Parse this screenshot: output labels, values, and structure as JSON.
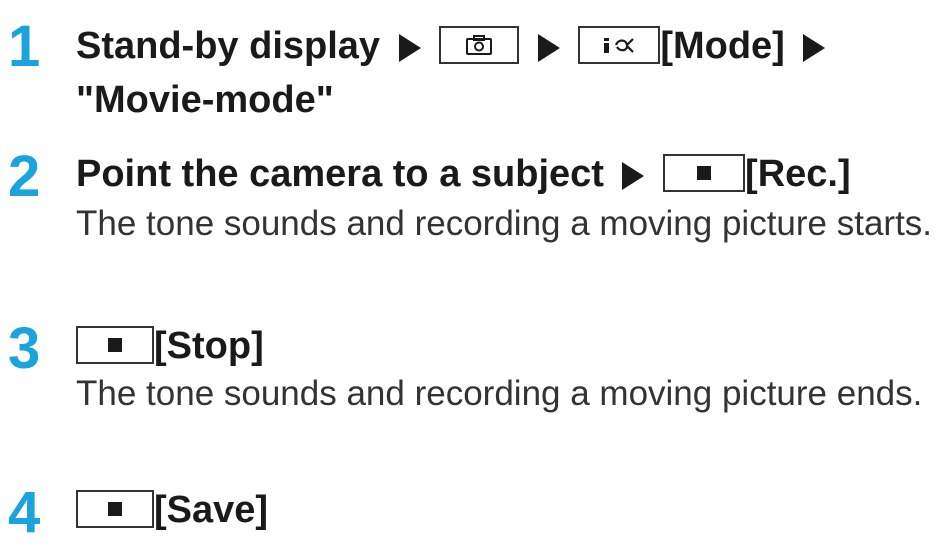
{
  "steps": [
    {
      "number": "1",
      "line1_prefix": "Stand-by display",
      "key_mode_label": "[Mode]",
      "line2": "\"Movie-mode\""
    },
    {
      "number": "2",
      "prefix": "Point the camera to a subject",
      "key_label": "[Rec.]",
      "description": "The tone sounds and recording a moving picture starts."
    },
    {
      "number": "3",
      "key_label": "[Stop]",
      "description": "The tone sounds and recording a moving picture ends."
    },
    {
      "number": "4",
      "key_label": "[Save]"
    }
  ],
  "icons": {
    "camera_key": "camera-key-icon",
    "mode_key": "i-alpha-key-icon",
    "center_key": "square-key-icon",
    "arrow": "right-triangle-arrow"
  },
  "colors": {
    "step_number": "#1aa3dc",
    "heading_text": "#1a1a1a",
    "body_text": "#333333"
  }
}
